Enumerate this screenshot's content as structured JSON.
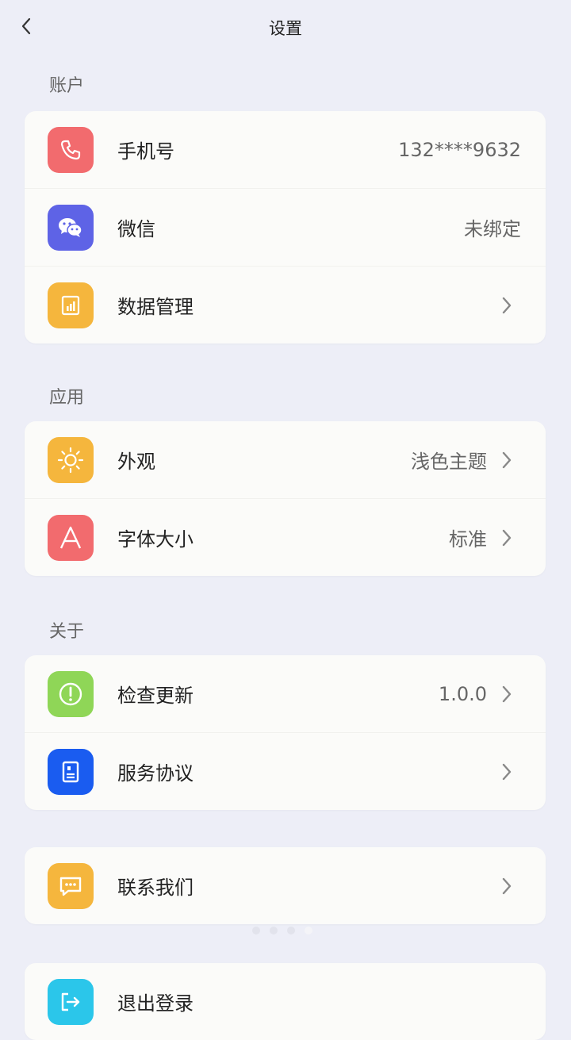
{
  "header": {
    "title": "设置",
    "back_icon": "chevron-left-icon"
  },
  "sections": {
    "account": {
      "label": "账户",
      "items": [
        {
          "label": "手机号",
          "value": "132****9632",
          "icon": "phone-icon",
          "color": "#F26B6E"
        },
        {
          "label": "微信",
          "value": "未绑定",
          "icon": "wechat-icon",
          "color": "#5E63E6"
        },
        {
          "label": "数据管理",
          "value": "",
          "icon": "data-icon",
          "color": "#F5B63D"
        }
      ]
    },
    "app": {
      "label": "应用",
      "items": [
        {
          "label": "外观",
          "value": "浅色主题",
          "icon": "sun-icon",
          "color": "#F5B63D"
        },
        {
          "label": "字体大小",
          "value": "标准",
          "icon": "font-icon",
          "color": "#F26B6E"
        }
      ]
    },
    "about": {
      "label": "关于",
      "items": [
        {
          "label": "检查更新",
          "value": "1.0.0",
          "icon": "update-icon",
          "color": "#8FD657"
        },
        {
          "label": "服务协议",
          "value": "",
          "icon": "document-icon",
          "color": "#1A5CF0"
        }
      ]
    },
    "contact": {
      "items": [
        {
          "label": "联系我们",
          "value": "",
          "icon": "message-icon",
          "color": "#F5B63D"
        }
      ]
    },
    "logout": {
      "items": [
        {
          "label": "退出登录",
          "value": "",
          "icon": "logout-icon",
          "color": "#2BC6EA"
        }
      ]
    }
  },
  "pagination": {
    "count": 4,
    "active_index": 3
  }
}
